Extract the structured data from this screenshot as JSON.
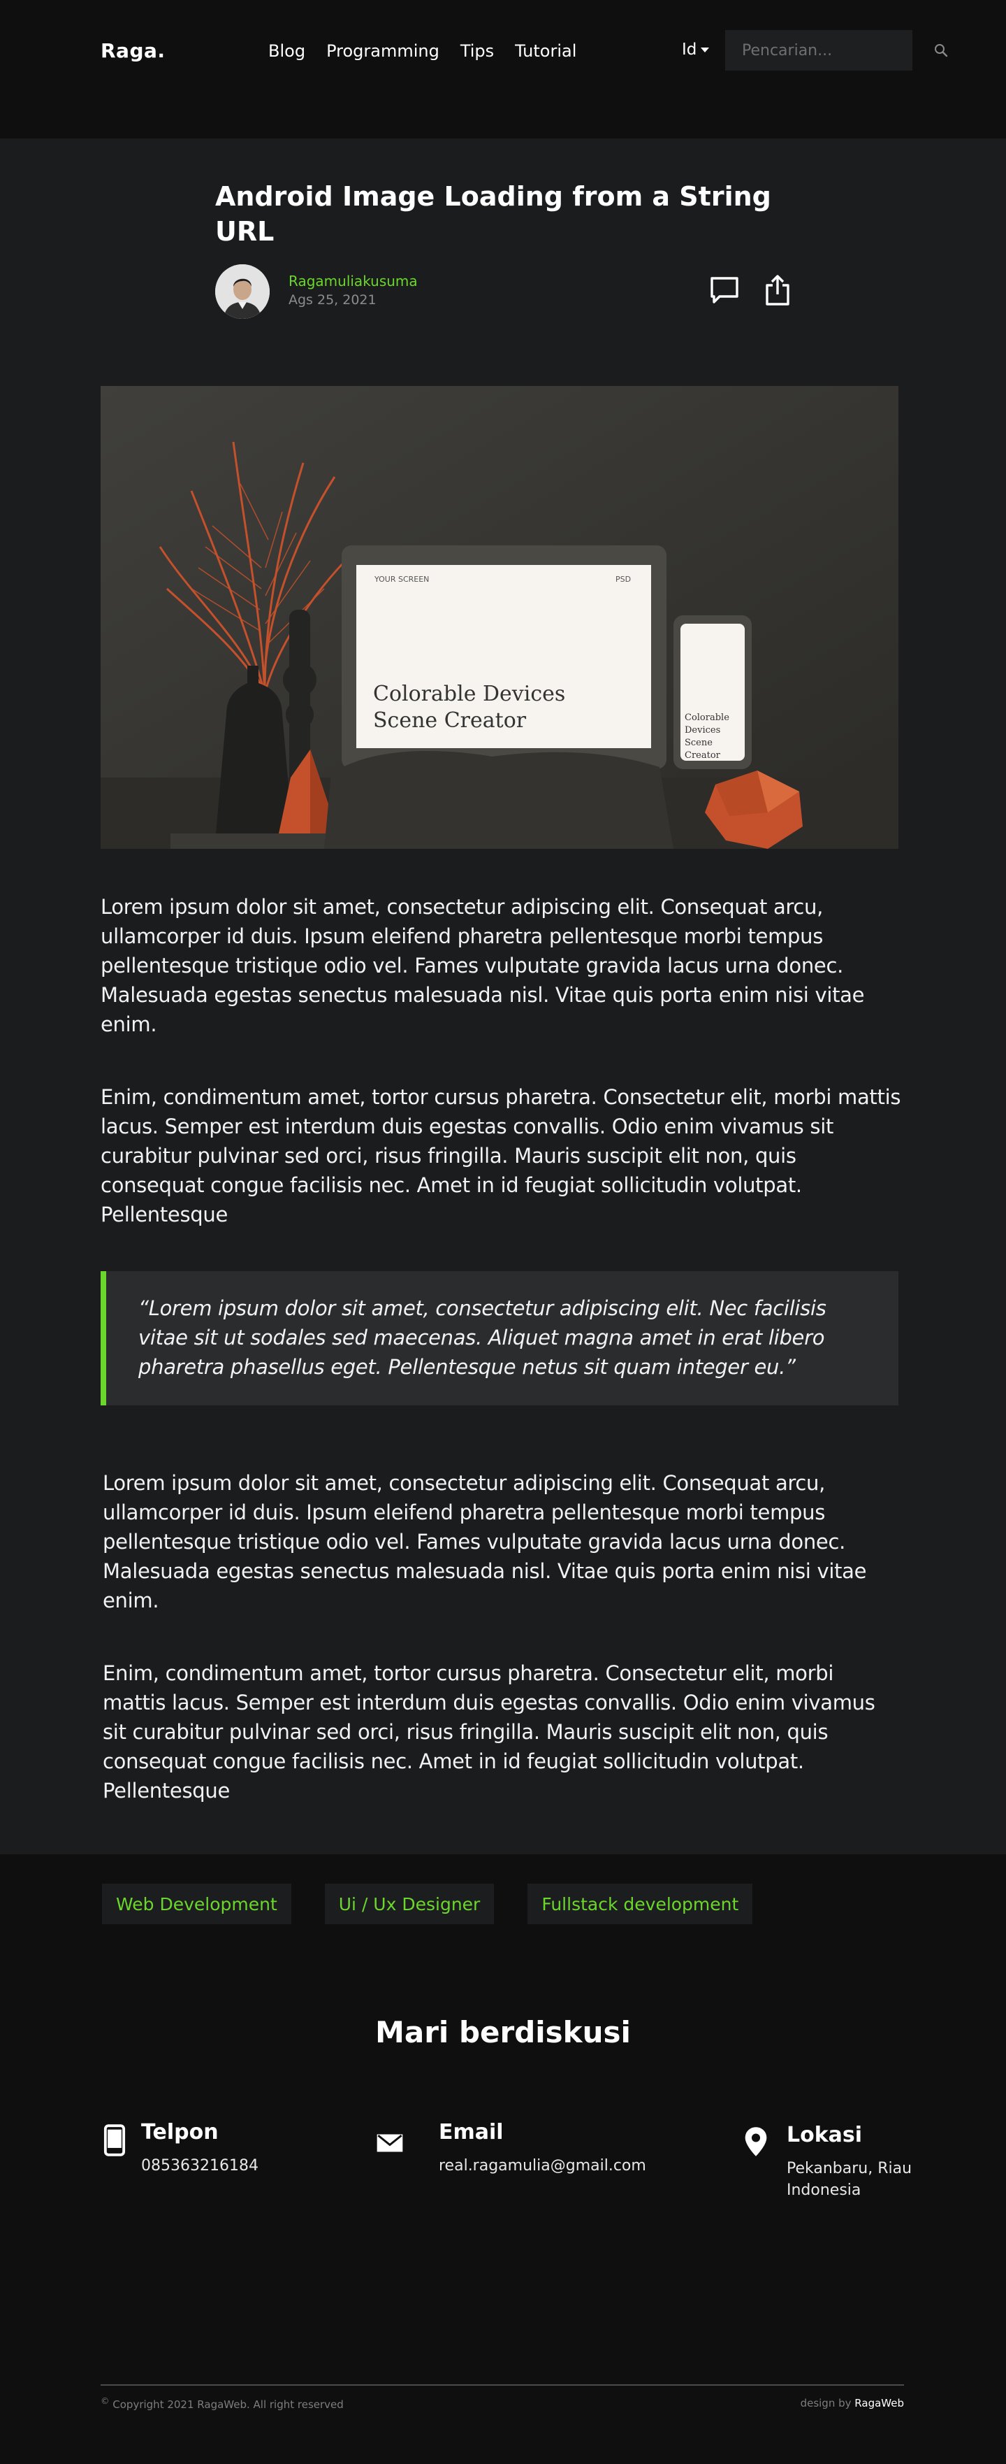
{
  "brand": {
    "logo": "Raga."
  },
  "nav": {
    "items": [
      {
        "label": "Blog"
      },
      {
        "label": "Programming"
      },
      {
        "label": "Tips"
      },
      {
        "label": "Tutorial"
      }
    ],
    "language": "Id",
    "search_placeholder": "Pencarian..."
  },
  "article": {
    "title": "Android Image Loading from a String URL",
    "author": "Ragamuliakusuma",
    "date": "Ags 25, 2021",
    "hero": {
      "laptop_header_left": "YOUR SCREEN",
      "laptop_header_right": "PSD",
      "laptop_title_line1": "Colorable Devices",
      "laptop_title_line2": "Scene Creator",
      "phone_text": [
        "Colorable",
        "Devices",
        "Scene",
        "Creator"
      ]
    },
    "paragraphs": [
      "Lorem ipsum dolor sit amet, consectetur adipiscing elit. Consequat arcu, ullamcorper id duis. Ipsum eleifend pharetra pellentesque morbi tempus pellentesque tristique odio vel. Fames vulputate gravida lacus urna donec. Malesuada egestas senectus malesuada nisl. Vitae quis porta enim nisi vitae enim.",
      "Enim, condimentum amet, tortor cursus pharetra. Consectetur elit, morbi mattis lacus. Semper est interdum duis egestas convallis. Odio enim vivamus sit curabitur pulvinar sed orci, risus fringilla. Mauris suscipit elit non, quis consequat congue facilisis nec. Amet in id feugiat sollicitudin volutpat. Pellentesque",
      "Lorem ipsum dolor sit amet, consectetur adipiscing elit. Consequat arcu, ullamcorper id duis. Ipsum eleifend pharetra pellentesque morbi tempus pellentesque tristique odio vel. Fames vulputate gravida lacus urna donec. Malesuada egestas senectus malesuada nisl. Vitae quis porta enim nisi vitae enim.",
      "Enim, condimentum amet, tortor cursus pharetra. Consectetur elit, morbi mattis lacus. Semper est interdum duis egestas convallis. Odio enim vivamus sit curabitur pulvinar sed orci, risus fringilla. Mauris suscipit elit non, quis consequat congue facilisis nec. Amet in id feugiat sollicitudin volutpat. Pellentesque"
    ],
    "quote": "“Lorem ipsum dolor sit amet, consectetur adipiscing elit. Nec facilisis vitae sit ut sodales sed maecenas. Aliquet magna amet in erat libero pharetra phasellus eget. Pellentesque netus sit quam integer eu.”"
  },
  "tags": [
    "Web Development",
    "Ui / Ux Designer",
    "Fullstack development"
  ],
  "discuss": {
    "title": "Mari berdiskusi",
    "contacts": {
      "phone": {
        "label": "Telpon",
        "value": "085363216184",
        "icon": "phone-icon"
      },
      "email": {
        "label": "Email",
        "value": "real.ragamulia@gmail.com",
        "icon": "mail-icon"
      },
      "location": {
        "label": "Lokasi",
        "value_line1": "Pekanbaru, Riau",
        "value_line2": "Indonesia",
        "icon": "location-pin-icon"
      }
    }
  },
  "footer": {
    "copyright_symbol": "©",
    "copyright": "Copyright 2021 RagaWeb. All right reserved",
    "designer_prefix": "design by",
    "designer_name": "RagaWeb"
  },
  "colors": {
    "accent": "#6bd62b",
    "page_bg": "#0f0f0f",
    "article_bg": "#1b1c1e",
    "quote_bg": "#2b2c2e",
    "tag_bg": "#1c1d1f"
  }
}
